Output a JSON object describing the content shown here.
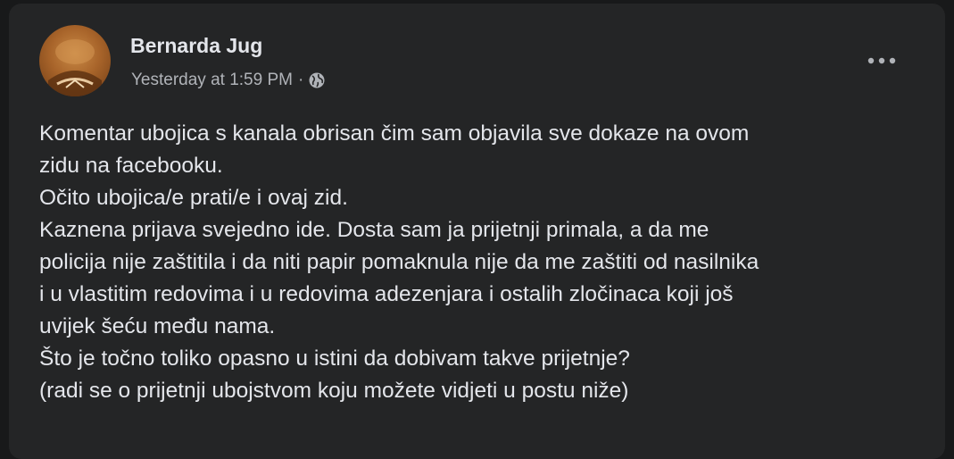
{
  "post": {
    "author": "Bernarda Jug",
    "timestamp": "Yesterday at 1:59 PM",
    "separator": "·",
    "audience_icon": "globe-icon",
    "more_icon": "more-options-icon",
    "lines": [
      "Komentar ubojica s kanala obrisan čim sam objavila sve dokaze na ovom",
      "zidu na facebooku.",
      "Očito ubojica/e prati/e i ovaj zid.",
      "Kaznena prijava svejedno ide. Dosta sam ja prijetnji primala, a da me",
      "policija nije zaštitila i da niti papir pomaknula nije da me zaštiti od nasilnika",
      "i u vlastitim redovima i u redovima adezenjara i ostalih zločinaca koji još",
      "uvijek šeću među nama.",
      "Što je točno toliko opasno u istini da dobivam takve prijetnje?",
      "(radi se o prijetnji ubojstvom koju možete vidjeti u postu niže)"
    ]
  },
  "colors": {
    "background": "#18191a",
    "card": "#242526",
    "primary_text": "#e4e6eb",
    "secondary_text": "#b0b3b8"
  }
}
